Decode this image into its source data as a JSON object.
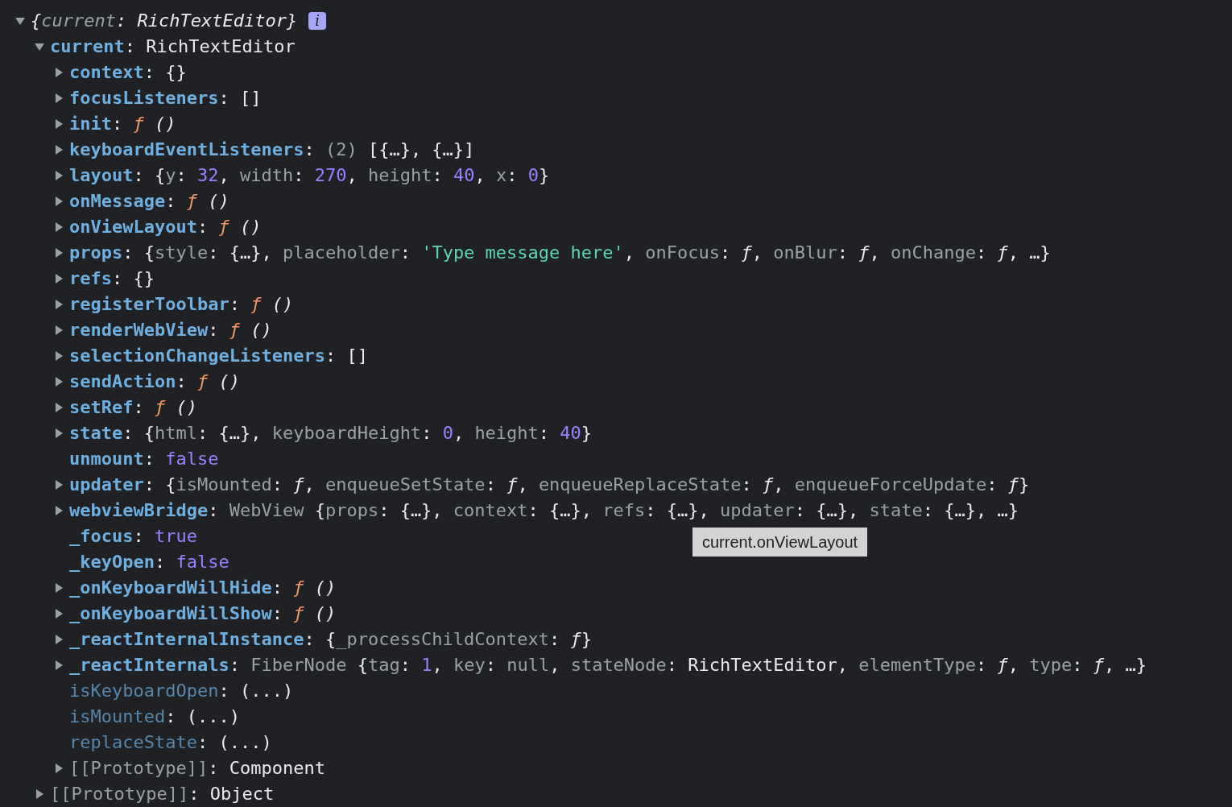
{
  "tree": {
    "summary": [
      {
        "kind": "punct",
        "text": "{"
      },
      {
        "kind": "subkey",
        "text": "current"
      },
      {
        "kind": "punct",
        "text": ": RichTextEditor}"
      }
    ],
    "badge": "i",
    "expandable": true,
    "expanded": true,
    "children": [
      {
        "key": "current",
        "kind": "own",
        "expandable": true,
        "expanded": true,
        "value": [
          {
            "kind": "punct",
            "text": ": RichTextEditor"
          }
        ],
        "children": [
          {
            "key": "context",
            "kind": "own",
            "expandable": true,
            "expanded": false,
            "value": [
              {
                "kind": "punct",
                "text": ": {}"
              }
            ]
          },
          {
            "key": "focusListeners",
            "kind": "own",
            "expandable": true,
            "expanded": false,
            "value": [
              {
                "kind": "punct",
                "text": ": []"
              }
            ]
          },
          {
            "key": "init",
            "kind": "own",
            "expandable": true,
            "expanded": false,
            "value": [
              {
                "kind": "punct",
                "text": ": "
              },
              {
                "kind": "func",
                "text": "ƒ"
              },
              {
                "kind": "italic",
                "text": " ()"
              }
            ]
          },
          {
            "key": "keyboardEventListeners",
            "kind": "own",
            "expandable": true,
            "expanded": false,
            "value": [
              {
                "kind": "punct",
                "text": ": "
              },
              {
                "kind": "dim",
                "text": "(2)"
              },
              {
                "kind": "punct",
                "text": " [{…}, {…}]"
              }
            ]
          },
          {
            "key": "layout",
            "kind": "own",
            "expandable": true,
            "expanded": false,
            "value": [
              {
                "kind": "punct",
                "text": ": {"
              },
              {
                "kind": "subkey",
                "text": "y"
              },
              {
                "kind": "punct",
                "text": ": "
              },
              {
                "kind": "number",
                "text": "32"
              },
              {
                "kind": "punct",
                "text": ", "
              },
              {
                "kind": "subkey",
                "text": "width"
              },
              {
                "kind": "punct",
                "text": ": "
              },
              {
                "kind": "number",
                "text": "270"
              },
              {
                "kind": "punct",
                "text": ", "
              },
              {
                "kind": "subkey",
                "text": "height"
              },
              {
                "kind": "punct",
                "text": ": "
              },
              {
                "kind": "number",
                "text": "40"
              },
              {
                "kind": "punct",
                "text": ", "
              },
              {
                "kind": "subkey",
                "text": "x"
              },
              {
                "kind": "punct",
                "text": ": "
              },
              {
                "kind": "number",
                "text": "0"
              },
              {
                "kind": "punct",
                "text": "}"
              }
            ]
          },
          {
            "key": "onMessage",
            "kind": "own",
            "expandable": true,
            "expanded": false,
            "value": [
              {
                "kind": "punct",
                "text": ": "
              },
              {
                "kind": "func",
                "text": "ƒ"
              },
              {
                "kind": "italic",
                "text": " ()"
              }
            ]
          },
          {
            "key": "onViewLayout",
            "kind": "own",
            "expandable": true,
            "expanded": false,
            "value": [
              {
                "kind": "punct",
                "text": ": "
              },
              {
                "kind": "func",
                "text": "ƒ"
              },
              {
                "kind": "italic",
                "text": " ()"
              }
            ]
          },
          {
            "key": "props",
            "kind": "own",
            "expandable": true,
            "expanded": false,
            "value": [
              {
                "kind": "punct",
                "text": ": {"
              },
              {
                "kind": "subkey",
                "text": "style"
              },
              {
                "kind": "punct",
                "text": ": {…}, "
              },
              {
                "kind": "subkey",
                "text": "placeholder"
              },
              {
                "kind": "punct",
                "text": ": "
              },
              {
                "kind": "string",
                "text": "'Type message here'"
              },
              {
                "kind": "punct",
                "text": ", "
              },
              {
                "kind": "subkey",
                "text": "onFocus"
              },
              {
                "kind": "punct",
                "text": ": "
              },
              {
                "kind": "italic",
                "text": "ƒ"
              },
              {
                "kind": "punct",
                "text": ", "
              },
              {
                "kind": "subkey",
                "text": "onBlur"
              },
              {
                "kind": "punct",
                "text": ": "
              },
              {
                "kind": "italic",
                "text": "ƒ"
              },
              {
                "kind": "punct",
                "text": ", "
              },
              {
                "kind": "subkey",
                "text": "onChange"
              },
              {
                "kind": "punct",
                "text": ": "
              },
              {
                "kind": "italic",
                "text": "ƒ"
              },
              {
                "kind": "punct",
                "text": ", …}"
              }
            ]
          },
          {
            "key": "refs",
            "kind": "own",
            "expandable": true,
            "expanded": false,
            "value": [
              {
                "kind": "punct",
                "text": ": {}"
              }
            ]
          },
          {
            "key": "registerToolbar",
            "kind": "own",
            "expandable": true,
            "expanded": false,
            "value": [
              {
                "kind": "punct",
                "text": ": "
              },
              {
                "kind": "func",
                "text": "ƒ"
              },
              {
                "kind": "italic",
                "text": " ()"
              }
            ]
          },
          {
            "key": "renderWebView",
            "kind": "own",
            "expandable": true,
            "expanded": false,
            "value": [
              {
                "kind": "punct",
                "text": ": "
              },
              {
                "kind": "func",
                "text": "ƒ"
              },
              {
                "kind": "italic",
                "text": " ()"
              }
            ]
          },
          {
            "key": "selectionChangeListeners",
            "kind": "own",
            "expandable": true,
            "expanded": false,
            "value": [
              {
                "kind": "punct",
                "text": ": []"
              }
            ]
          },
          {
            "key": "sendAction",
            "kind": "own",
            "expandable": true,
            "expanded": false,
            "value": [
              {
                "kind": "punct",
                "text": ": "
              },
              {
                "kind": "func",
                "text": "ƒ"
              },
              {
                "kind": "italic",
                "text": " ()"
              }
            ]
          },
          {
            "key": "setRef",
            "kind": "own",
            "expandable": true,
            "expanded": false,
            "value": [
              {
                "kind": "punct",
                "text": ": "
              },
              {
                "kind": "func",
                "text": "ƒ"
              },
              {
                "kind": "italic",
                "text": " ()"
              }
            ]
          },
          {
            "key": "state",
            "kind": "own",
            "expandable": true,
            "expanded": false,
            "value": [
              {
                "kind": "punct",
                "text": ": {"
              },
              {
                "kind": "subkey",
                "text": "html"
              },
              {
                "kind": "punct",
                "text": ": {…}, "
              },
              {
                "kind": "subkey",
                "text": "keyboardHeight"
              },
              {
                "kind": "punct",
                "text": ": "
              },
              {
                "kind": "number",
                "text": "0"
              },
              {
                "kind": "punct",
                "text": ", "
              },
              {
                "kind": "subkey",
                "text": "height"
              },
              {
                "kind": "punct",
                "text": ": "
              },
              {
                "kind": "number",
                "text": "40"
              },
              {
                "kind": "punct",
                "text": "}"
              }
            ]
          },
          {
            "key": "unmount",
            "kind": "own",
            "expandable": false,
            "value": [
              {
                "kind": "punct",
                "text": ": "
              },
              {
                "kind": "number",
                "text": "false"
              }
            ]
          },
          {
            "key": "updater",
            "kind": "own",
            "expandable": true,
            "expanded": false,
            "value": [
              {
                "kind": "punct",
                "text": ": {"
              },
              {
                "kind": "subkey",
                "text": "isMounted"
              },
              {
                "kind": "punct",
                "text": ": "
              },
              {
                "kind": "italic",
                "text": "ƒ"
              },
              {
                "kind": "punct",
                "text": ", "
              },
              {
                "kind": "subkey",
                "text": "enqueueSetState"
              },
              {
                "kind": "punct",
                "text": ": "
              },
              {
                "kind": "italic",
                "text": "ƒ"
              },
              {
                "kind": "punct",
                "text": ", "
              },
              {
                "kind": "subkey",
                "text": "enqueueReplaceState"
              },
              {
                "kind": "punct",
                "text": ": "
              },
              {
                "kind": "italic",
                "text": "ƒ"
              },
              {
                "kind": "punct",
                "text": ", "
              },
              {
                "kind": "subkey",
                "text": "enqueueForceUpdate"
              },
              {
                "kind": "punct",
                "text": ": "
              },
              {
                "kind": "italic",
                "text": "ƒ"
              },
              {
                "kind": "punct",
                "text": "}"
              }
            ]
          },
          {
            "key": "webviewBridge",
            "kind": "own",
            "expandable": true,
            "expanded": false,
            "value": [
              {
                "kind": "punct",
                "text": ": "
              },
              {
                "kind": "subkey",
                "text": "WebView"
              },
              {
                "kind": "punct",
                "text": " {"
              },
              {
                "kind": "subkey",
                "text": "props"
              },
              {
                "kind": "punct",
                "text": ": {…}, "
              },
              {
                "kind": "subkey",
                "text": "context"
              },
              {
                "kind": "punct",
                "text": ": {…}, "
              },
              {
                "kind": "subkey",
                "text": "refs"
              },
              {
                "kind": "punct",
                "text": ": {…}, "
              },
              {
                "kind": "subkey",
                "text": "updater"
              },
              {
                "kind": "punct",
                "text": ": {…}, "
              },
              {
                "kind": "subkey",
                "text": "state"
              },
              {
                "kind": "punct",
                "text": ": {…}, …}"
              }
            ]
          },
          {
            "key": "_focus",
            "kind": "own",
            "expandable": false,
            "value": [
              {
                "kind": "punct",
                "text": ": "
              },
              {
                "kind": "number",
                "text": "true"
              }
            ]
          },
          {
            "key": "_keyOpen",
            "kind": "own",
            "expandable": false,
            "value": [
              {
                "kind": "punct",
                "text": ": "
              },
              {
                "kind": "number",
                "text": "false"
              }
            ]
          },
          {
            "key": "_onKeyboardWillHide",
            "kind": "own",
            "expandable": true,
            "expanded": false,
            "value": [
              {
                "kind": "punct",
                "text": ": "
              },
              {
                "kind": "func",
                "text": "ƒ"
              },
              {
                "kind": "italic",
                "text": " ()"
              }
            ]
          },
          {
            "key": "_onKeyboardWillShow",
            "kind": "own",
            "expandable": true,
            "expanded": false,
            "value": [
              {
                "kind": "punct",
                "text": ": "
              },
              {
                "kind": "func",
                "text": "ƒ"
              },
              {
                "kind": "italic",
                "text": " ()"
              }
            ]
          },
          {
            "key": "_reactInternalInstance",
            "kind": "own",
            "expandable": true,
            "expanded": false,
            "value": [
              {
                "kind": "punct",
                "text": ": {"
              },
              {
                "kind": "subkey",
                "text": "_processChildContext"
              },
              {
                "kind": "punct",
                "text": ": "
              },
              {
                "kind": "italic",
                "text": "ƒ"
              },
              {
                "kind": "punct",
                "text": "}"
              }
            ]
          },
          {
            "key": "_reactInternals",
            "kind": "own",
            "expandable": true,
            "expanded": false,
            "value": [
              {
                "kind": "punct",
                "text": ": "
              },
              {
                "kind": "subkey",
                "text": "FiberNode"
              },
              {
                "kind": "punct",
                "text": " {"
              },
              {
                "kind": "subkey",
                "text": "tag"
              },
              {
                "kind": "punct",
                "text": ": "
              },
              {
                "kind": "number",
                "text": "1"
              },
              {
                "kind": "punct",
                "text": ", "
              },
              {
                "kind": "subkey",
                "text": "key"
              },
              {
                "kind": "punct",
                "text": ": "
              },
              {
                "kind": "dim",
                "text": "null"
              },
              {
                "kind": "punct",
                "text": ", "
              },
              {
                "kind": "subkey",
                "text": "stateNode"
              },
              {
                "kind": "punct",
                "text": ": RichTextEditor, "
              },
              {
                "kind": "subkey",
                "text": "elementType"
              },
              {
                "kind": "punct",
                "text": ": "
              },
              {
                "kind": "italic",
                "text": "ƒ"
              },
              {
                "kind": "punct",
                "text": ", "
              },
              {
                "kind": "subkey",
                "text": "type"
              },
              {
                "kind": "punct",
                "text": ": "
              },
              {
                "kind": "italic",
                "text": "ƒ"
              },
              {
                "kind": "punct",
                "text": ", …}"
              }
            ]
          },
          {
            "key": "isKeyboardOpen",
            "kind": "accessor",
            "expandable": false,
            "value": [
              {
                "kind": "punct",
                "text": ": (...)"
              }
            ]
          },
          {
            "key": "isMounted",
            "kind": "accessor",
            "expandable": false,
            "value": [
              {
                "kind": "punct",
                "text": ": (...)"
              }
            ]
          },
          {
            "key": "replaceState",
            "kind": "accessor",
            "expandable": false,
            "value": [
              {
                "kind": "punct",
                "text": ": (...)"
              }
            ]
          },
          {
            "key": "[[Prototype]]",
            "kind": "internal",
            "expandable": true,
            "expanded": false,
            "value": [
              {
                "kind": "punct",
                "text": ": Component"
              }
            ]
          }
        ]
      },
      {
        "key": "[[Prototype]]",
        "kind": "internal",
        "expandable": true,
        "expanded": false,
        "value": [
          {
            "kind": "punct",
            "text": ": Object"
          }
        ]
      }
    ]
  },
  "tooltip": {
    "text": "current.onViewLayout"
  }
}
